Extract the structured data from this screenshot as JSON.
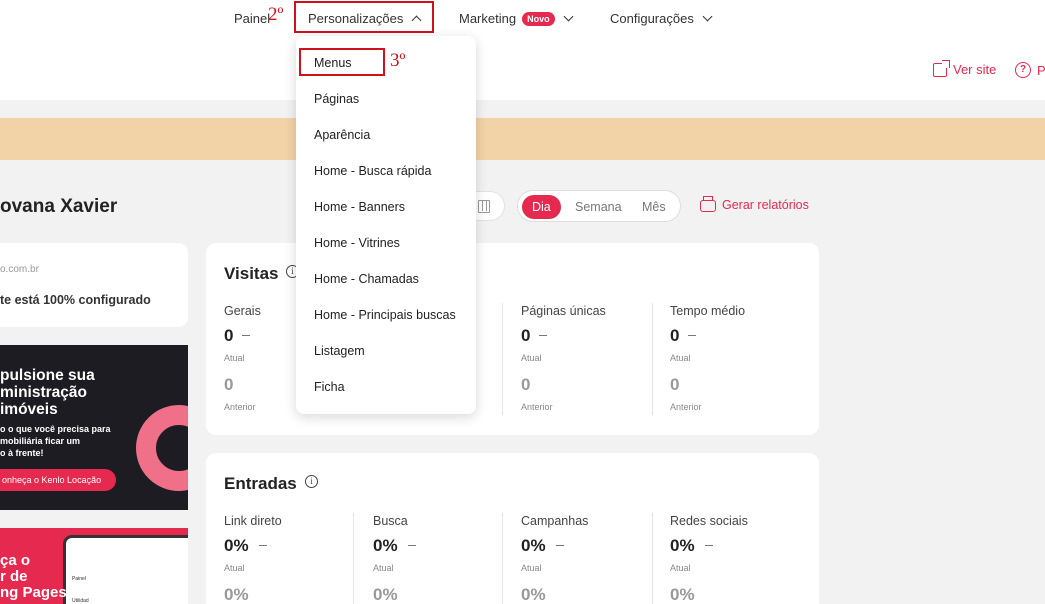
{
  "nav": {
    "items": [
      {
        "label": "Painel"
      },
      {
        "label": "Personalizações"
      },
      {
        "label": "Marketing",
        "badge": "Novo"
      },
      {
        "label": "Configurações"
      }
    ],
    "annotation_step2": "2º",
    "annotation_step3": "3º"
  },
  "header_links": {
    "view_site": "Ver site",
    "help_partial": "P"
  },
  "dropdown": {
    "items": [
      "Menus",
      "Páginas",
      "Aparência",
      "Home - Busca rápida",
      "Home - Banners",
      "Home - Vitrines",
      "Home - Chamadas",
      "Home - Principais buscas",
      "Listagem",
      "Ficha"
    ]
  },
  "greeting": "ovana Xavier",
  "period": {
    "options": [
      "Dia",
      "Semana",
      "Mês"
    ],
    "selected": "Dia"
  },
  "reports_label": "Gerar relatórios",
  "site_card": {
    "domain": "o.com.br",
    "status": "te está 100% configurado"
  },
  "promo1": {
    "title": "pulsione sua\nministração\nimóveis",
    "subtitle": "o o que você precisa para\nmobiliária ficar um\no à frente!",
    "cta": "onheça o Kenlo Locação"
  },
  "promo2": {
    "title": "ça o\nr de\nng Pages",
    "mini1": "Painel",
    "mini2": "Utilidad"
  },
  "visits": {
    "title": "Visitas",
    "metrics": [
      {
        "label": "Gerais",
        "value": "0",
        "value_caption": "Atual",
        "previous": "0",
        "previous_caption": "Anterior"
      },
      {
        "label": "Páginas únicas",
        "value": "0",
        "value_caption": "Atual",
        "previous": "0",
        "previous_caption": "Anterior"
      },
      {
        "label": "Tempo médio",
        "value": "0",
        "value_caption": "Atual",
        "previous": "0",
        "previous_caption": "Anterior"
      }
    ]
  },
  "entries": {
    "title": "Entradas",
    "metrics": [
      {
        "label": "Link direto",
        "value": "0%",
        "value_caption": "Atual",
        "previous": "0%"
      },
      {
        "label": "Busca",
        "value": "0%",
        "value_caption": "Atual",
        "previous": "0%"
      },
      {
        "label": "Campanhas",
        "value": "0%",
        "value_caption": "Atual",
        "previous": "0%"
      },
      {
        "label": "Redes sociais",
        "value": "0%",
        "value_caption": "Atual",
        "previous": "0%"
      }
    ]
  },
  "colors": {
    "accent": "#e5294f",
    "annotation_red": "#d0101b",
    "banner": "#f2d3a7"
  }
}
